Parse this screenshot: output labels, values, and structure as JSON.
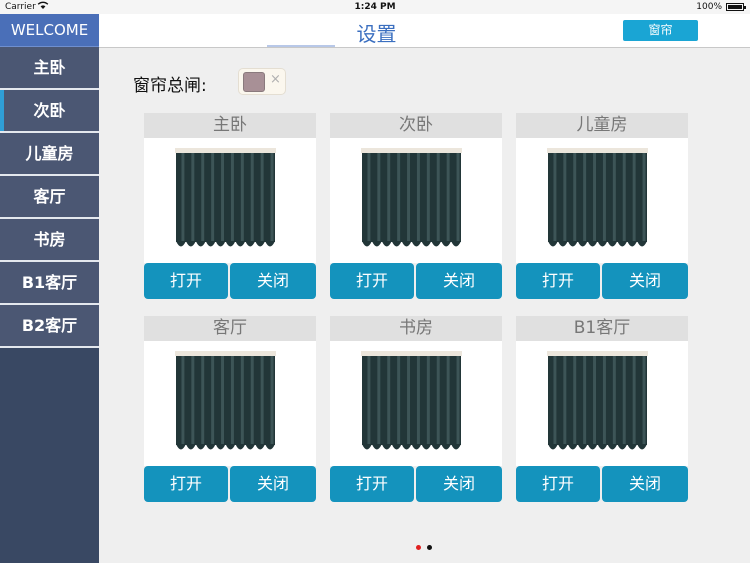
{
  "status_bar": {
    "carrier": "Carrier",
    "time": "1:24 PM",
    "battery": "100%"
  },
  "sidebar": {
    "welcome": "WELCOME",
    "items": [
      {
        "label": "主卧",
        "active": false
      },
      {
        "label": "次卧",
        "active": true
      },
      {
        "label": "儿童房",
        "active": false
      },
      {
        "label": "客厅",
        "active": false
      },
      {
        "label": "书房",
        "active": false
      },
      {
        "label": "B1客厅",
        "active": false
      },
      {
        "label": "B2客厅",
        "active": false
      }
    ]
  },
  "header": {
    "title": "设置",
    "nav_button": "窗帘"
  },
  "master": {
    "label": "窗帘总闸:",
    "close_glyph": "×"
  },
  "cards": [
    {
      "title": "主卧",
      "open": "打开",
      "close": "关闭"
    },
    {
      "title": "次卧",
      "open": "打开",
      "close": "关闭"
    },
    {
      "title": "儿童房",
      "open": "打开",
      "close": "关闭"
    },
    {
      "title": "客厅",
      "open": "打开",
      "close": "关闭"
    },
    {
      "title": "书房",
      "open": "打开",
      "close": "关闭"
    },
    {
      "title": "B1客厅",
      "open": "打开",
      "close": "关闭"
    }
  ],
  "pagination": {
    "current_page": 1,
    "total_pages": 2
  },
  "colors": {
    "sidebar_bg": "#394863",
    "welcome_bg": "#4a6fb8",
    "accent": "#1aa5d4",
    "button": "#1493bd",
    "title_blue": "#3b6fc0",
    "curtain_dark": "#223638",
    "curtain_stripe": "#3d5557"
  },
  "icons": {
    "curtain": "curtain-icon",
    "wifi": "wifi-icon",
    "battery": "battery-icon"
  }
}
